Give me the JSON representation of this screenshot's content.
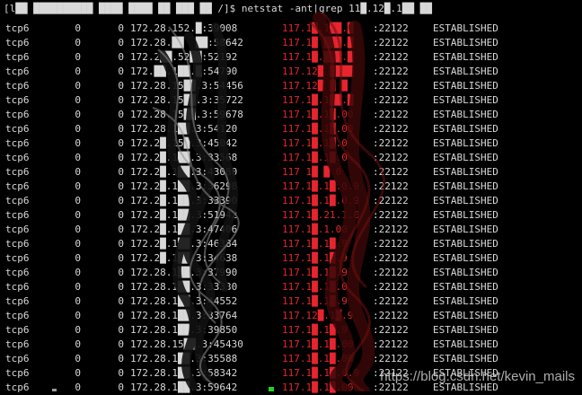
{
  "terminal": {
    "command_line": "[l██ ██████████ ████ ████ ██ ███ ██ /]$ netstat -ant|grep 11█.12█.1██ ██",
    "rows": [
      {
        "proto": "tcp6",
        "recv_q": "0",
        "send_q": "0",
        "local": "172.28.152.█:39008",
        "foreign": "117.1█.1██.█",
        "foreign_port": ":22122",
        "state": "ESTABLISHED"
      },
      {
        "proto": "tcp6",
        "recv_q": "0",
        "send_q": "0",
        "local": "172.28.██  ██:58642",
        "foreign": "117.1█ ███.█",
        "foreign_port": ":22122",
        "state": "ESTABLISHED"
      },
      {
        "proto": "tcp6",
        "recv_q": "0",
        "send_q": "0",
        "local": "172.2██.52██:52192",
        "foreign": "117.1█.███.█",
        "foreign_port": ":22122",
        "state": "ESTABLISHED"
      },
      {
        "proto": "tcp6",
        "recv_q": "0",
        "send_q": "0",
        "local": "172.██.1██.█:54790",
        "foreign": "117.12█ ████",
        "foreign_port": ":22122",
        "state": "ESTABLISHED"
      },
      {
        "proto": "tcp6",
        "recv_q": "0",
        "send_q": "0",
        "local": "172.28.15██.3:54456",
        "foreign": "117.12█ █ █",
        "foreign_port": ":22122",
        "state": "ESTABLISHED"
      },
      {
        "proto": "tcp6",
        "recv_q": "0",
        "send_q": "0",
        "local": "172.28.15██.3:35722",
        "foreign": "117.1█.1██.█",
        "foreign_port": ":22122",
        "state": "ESTABLISHED"
      },
      {
        "proto": "tcp6",
        "recv_q": "0",
        "send_q": "0",
        "local": "172.28.15██.3:59678",
        "foreign": "117.1█.1█.00",
        "foreign_port": ":22122",
        "state": "ESTABLISHED"
      },
      {
        "proto": "tcp6",
        "recv_q": "0",
        "send_q": "0",
        "local": "172.28.1██.3:54120",
        "foreign": "117.1█.1█.00",
        "foreign_port": ":22122",
        "state": "ESTABLISHED"
      },
      {
        "proto": "tcp6",
        "recv_q": "0",
        "send_q": "0",
        "local": "172.2█.15█.3:45042",
        "foreign": "117.1█.1█.0",
        "foreign_port": ":22122",
        "state": "ESTABLISHED"
      },
      {
        "proto": "tcp6",
        "recv_q": "0",
        "send_q": "0",
        "local": "172.2█.1██.3:33568",
        "foreign": "117.1█.1█.0",
        "foreign_port": ":22122",
        "state": "ESTABLISHED"
      },
      {
        "proto": "tcp6",
        "recv_q": "0",
        "send_q": "0",
        "local": "172.2█.1██.3:43080",
        "foreign": "117 1█ █ 0",
        "foreign_port": ":22122",
        "state": "ESTABLISHED"
      },
      {
        "proto": "tcp6",
        "recv_q": "0",
        "send_q": "0",
        "local": "172.2█.1██.3:36298",
        "foreign": "117.1█.1█.0.9",
        "foreign_port": ":22122",
        "state": "ESTABLISHED"
      },
      {
        "proto": "tcp6",
        "recv_q": "0",
        "send_q": "0",
        "local": "172.2█.1██.3:33390",
        "foreign": "117.1█.1█.0.9",
        "foreign_port": ":22122",
        "state": "ESTABLISHED"
      },
      {
        "proto": "tcp6",
        "recv_q": "0",
        "send_q": "0",
        "local": "172.2█.1██.3:51942",
        "foreign": "117.1█.21.1.0",
        "foreign_port": ":22122",
        "state": "ESTABLISHED"
      },
      {
        "proto": "tcp6",
        "recv_q": "0",
        "send_q": "0",
        "local": "172.2█.1██.3:47406",
        "foreign": "117.1█.1.00",
        "foreign_port": ":22122",
        "state": "ESTABLISHED"
      },
      {
        "proto": "tcp6",
        "recv_q": "0",
        "send_q": "0",
        "local": "172.2█.1██.3:46384",
        "foreign": "117.1█.1█.9",
        "foreign_port": ":22122",
        "state": "ESTABLISHED"
      },
      {
        "proto": "tcp6",
        "recv_q": "0",
        "send_q": "0",
        "local": "172.2█.1██.3:34638",
        "foreign": "117.1█.1█.9",
        "foreign_port": ":22122",
        "state": "ESTABLISHED"
      },
      {
        "proto": "tcp6",
        "recv_q": "0",
        "send_q": "0",
        "local": "172.28.1██.3:37990",
        "foreign": "117.1█.1█.9",
        "foreign_port": ":22122",
        "state": "ESTABLISHED"
      },
      {
        "proto": "tcp6",
        "recv_q": "0",
        "send_q": "0",
        "local": "172.28.1██.3:33330",
        "foreign": "117.1█.1█.0",
        "foreign_port": ":22122",
        "state": "ESTABLISHED"
      },
      {
        "proto": "tcp6",
        "recv_q": "0",
        "send_q": "0",
        "local": "172.28.1██.3:44552",
        "foreign": "117.1█.1█.9",
        "foreign_port": ":22122",
        "state": "ESTABLISHED"
      },
      {
        "proto": "tcp6",
        "recv_q": "0",
        "send_q": "0",
        "local": "172.28.1██.3:33764",
        "foreign": "117.12█.1█.9",
        "foreign_port": ":22122",
        "state": "ESTABLISHED"
      },
      {
        "proto": "tcp6",
        "recv_q": "0",
        "send_q": "0",
        "local": "172.28.1██.3:39850",
        "foreign": "117.1█.1█.9",
        "foreign_port": ":22122",
        "state": "ESTABLISHED"
      },
      {
        "proto": "tcp6",
        "recv_q": "0",
        "send_q": "0",
        "local": "172.28.15██.3:45430",
        "foreign": "117.1█.1█.00",
        "foreign_port": ":22122",
        "state": "ESTABLISHED"
      },
      {
        "proto": "tcp6",
        "recv_q": "0",
        "send_q": "0",
        "local": "172.28.1██.3:35588",
        "foreign": "117.1█.1█.00",
        "foreign_port": ":22122",
        "state": "ESTABLISHED"
      },
      {
        "proto": "tcp6",
        "recv_q": "0",
        "send_q": "0",
        "local": "172.28.1██.3:58342",
        "foreign": "117.1█.1█.0.9",
        "foreign_port": ":22122",
        "state": "ESTABLISHED"
      },
      {
        "proto": "tcp6",
        "recv_q": "0",
        "send_q": "0",
        "local": "172.28.1██.3:59642",
        "foreign": "117.1█.1█.00",
        "foreign_port": ":22122",
        "state": "ESTABLISHED"
      }
    ]
  },
  "watermark": "https://blog.csdn.net/kevin_mails",
  "colors": {
    "background": "#000000",
    "text": "#d8d8d8",
    "foreign_address": "#e8242e",
    "cursor": "#1fd51f"
  }
}
